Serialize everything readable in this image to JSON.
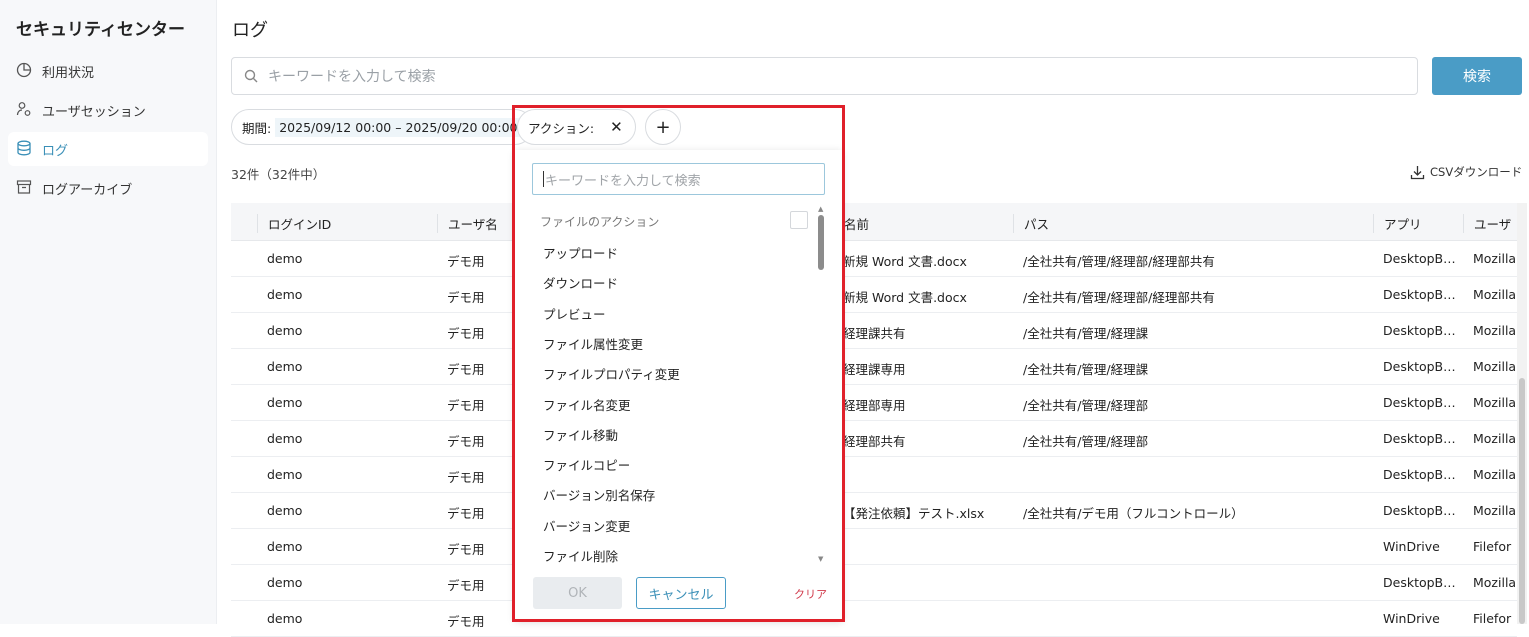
{
  "sidebar": {
    "brand": "セキュリティセンター",
    "items": [
      {
        "label": "利用状況"
      },
      {
        "label": "ユーザセッション"
      },
      {
        "label": "ログ"
      },
      {
        "label": "ログアーカイブ"
      }
    ]
  },
  "header": {
    "title": "ログ"
  },
  "search": {
    "placeholder": "キーワードを入力して検索",
    "button": "検索"
  },
  "filters": {
    "period_label": "期間:",
    "period_value": "2025/09/12 00:00 – 2025/09/20 00:00",
    "action_label": "アクション:",
    "add": "+"
  },
  "count": "32件（32件中）",
  "csv": "CSVダウンロード",
  "table": {
    "headers": [
      "ログインID",
      "ユーザ名",
      "名前",
      "パス",
      "アプリ",
      "ユーザ"
    ],
    "rows": [
      [
        "demo",
        "デモ用",
        "新規 Word 文書.docx",
        "/全社共有/管理/経理部/経理部共有",
        "DesktopB…",
        "Mozilla"
      ],
      [
        "demo",
        "デモ用",
        "新規 Word 文書.docx",
        "/全社共有/管理/経理部/経理部共有",
        "DesktopB…",
        "Mozilla"
      ],
      [
        "demo",
        "デモ用",
        "経理課共有",
        "/全社共有/管理/経理課",
        "DesktopB…",
        "Mozilla"
      ],
      [
        "demo",
        "デモ用",
        "経理課専用",
        "/全社共有/管理/経理課",
        "DesktopB…",
        "Mozilla"
      ],
      [
        "demo",
        "デモ用",
        "経理部専用",
        "/全社共有/管理/経理部",
        "DesktopB…",
        "Mozilla"
      ],
      [
        "demo",
        "デモ用",
        "経理部共有",
        "/全社共有/管理/経理部",
        "DesktopB…",
        "Mozilla"
      ],
      [
        "demo",
        "デモ用",
        "",
        "",
        "DesktopB…",
        "Mozilla"
      ],
      [
        "demo",
        "デモ用",
        "【発注依頼】テスト.xlsx",
        "/全社共有/デモ用（フルコントロール）",
        "DesktopB…",
        "Mozilla"
      ],
      [
        "demo",
        "デモ用",
        "",
        "",
        "WinDrive",
        "Filefor"
      ],
      [
        "demo",
        "デモ用",
        "",
        "",
        "DesktopB…",
        "Mozilla"
      ],
      [
        "demo",
        "デモ用",
        "",
        "",
        "WinDrive",
        "Filefor"
      ]
    ]
  },
  "dropdown": {
    "placeholder": "キーワードを入力して検索",
    "group": "ファイルのアクション",
    "options": [
      "アップロード",
      "ダウンロード",
      "プレビュー",
      "ファイル属性変更",
      "ファイルプロパティ変更",
      "ファイル名変更",
      "ファイル移動",
      "ファイルコピー",
      "バージョン別名保存",
      "バージョン変更",
      "ファイル削除"
    ],
    "ok": "OK",
    "cancel": "キャンセル",
    "clear": "クリア"
  }
}
